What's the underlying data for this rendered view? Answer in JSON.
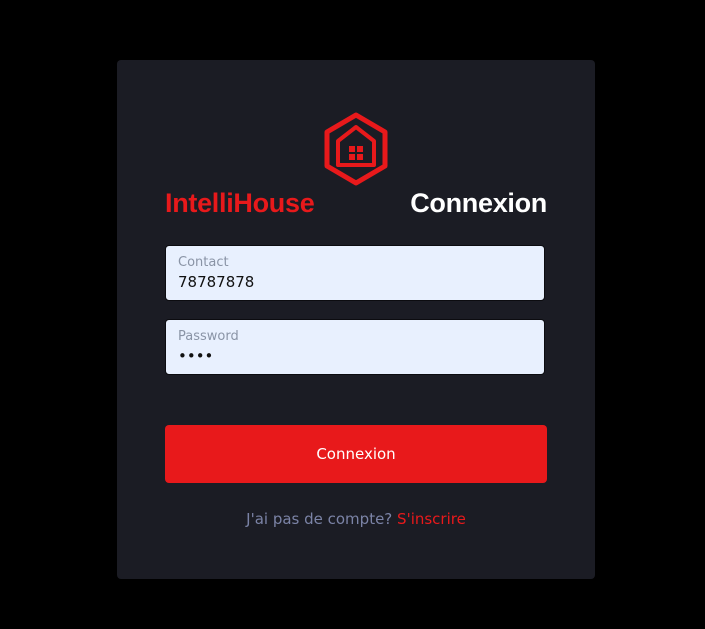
{
  "app": {
    "brand": "IntelliHouse",
    "title": "Connexion",
    "logo_icon": "house-hexagon-icon",
    "accent_color": "#e8191b"
  },
  "form": {
    "contact": {
      "label": "Contact",
      "value": "78787878"
    },
    "password": {
      "label": "Password",
      "value": "••••"
    },
    "submit_label": "Connexion"
  },
  "footer": {
    "question": "J'ai pas de compte?",
    "signup_link": "S'inscrire"
  }
}
